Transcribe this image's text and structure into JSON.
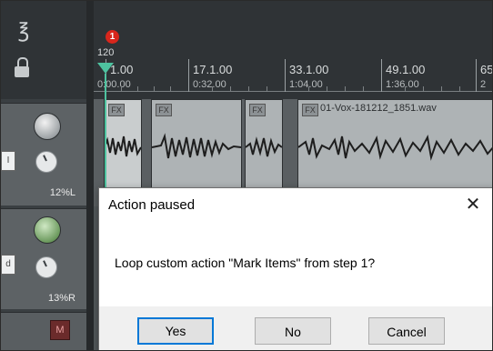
{
  "ruler": {
    "marker_number": "1",
    "tempo": "120",
    "bars": [
      "1.00",
      "17.1.00",
      "33.1.00",
      "49.1.00",
      "65"
    ],
    "times": [
      "0:00.00",
      "0:32.00",
      "1:04.00",
      "1:36.00",
      "2"
    ]
  },
  "tracks": [
    {
      "pan": "12%L"
    },
    {
      "pan": "13%R"
    },
    {
      "mute": "M"
    }
  ],
  "items": [
    {
      "fx": "FX",
      "name": ""
    },
    {
      "fx": "FX",
      "name": ""
    },
    {
      "fx": "FX",
      "name": ""
    },
    {
      "fx": "FX",
      "name": "01-Vox-181212_1851.wav"
    }
  ],
  "dialog": {
    "title": "Action paused",
    "message": "Loop custom action \"Mark Items\" from step 1?",
    "buttons": {
      "yes": "Yes",
      "no": "No",
      "cancel": "Cancel"
    }
  },
  "colors": {
    "play_cursor": "#4ec3a0",
    "marker": "#d8261c",
    "default_button_border": "#0078d7"
  }
}
